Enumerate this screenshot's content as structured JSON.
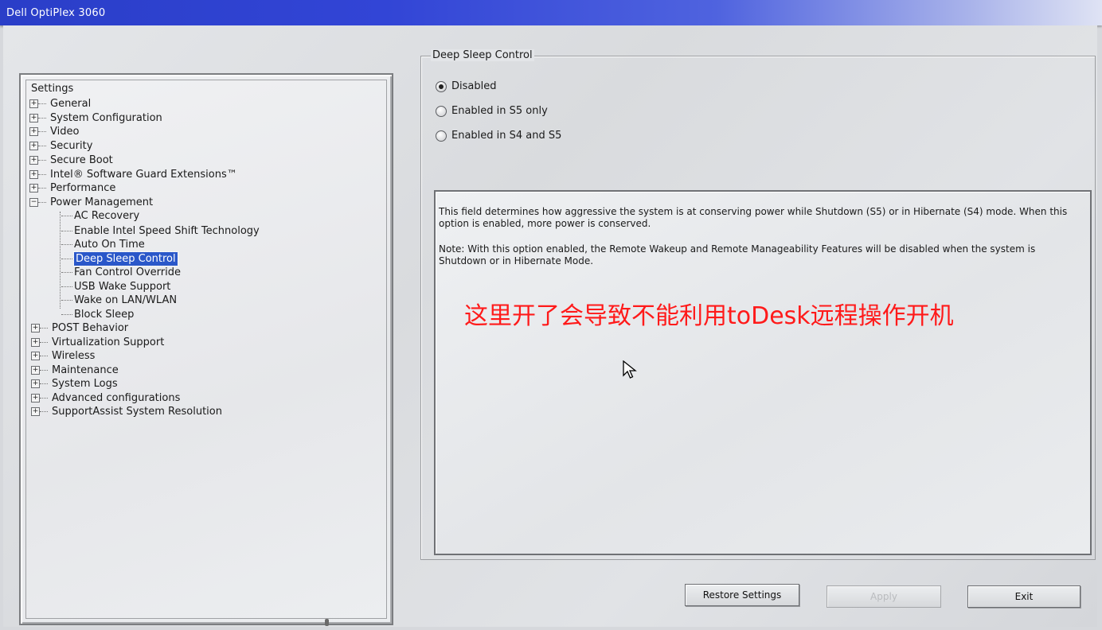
{
  "window": {
    "title": "Dell OptiPlex 3060"
  },
  "tree": {
    "root_label": "Settings",
    "items_before": [
      {
        "label": "General",
        "expander": "+"
      },
      {
        "label": "System Configuration",
        "expander": "+"
      },
      {
        "label": "Video",
        "expander": "+"
      },
      {
        "label": "Security",
        "expander": "+"
      },
      {
        "label": "Secure Boot",
        "expander": "+"
      },
      {
        "label": "Intel® Software Guard Extensions™",
        "expander": "+"
      },
      {
        "label": "Performance",
        "expander": "+"
      },
      {
        "label": "Power Management",
        "expander": "−"
      }
    ],
    "power_children": [
      {
        "label": "AC Recovery"
      },
      {
        "label": "Enable Intel Speed Shift Technology"
      },
      {
        "label": "Auto On Time"
      },
      {
        "label": "Deep Sleep Control",
        "selected": true
      },
      {
        "label": "Fan Control Override"
      },
      {
        "label": "USB Wake Support"
      },
      {
        "label": "Wake on LAN/WLAN"
      },
      {
        "label": "Block Sleep"
      }
    ],
    "items_after": [
      {
        "label": "POST Behavior",
        "expander": "+"
      },
      {
        "label": "Virtualization Support",
        "expander": "+"
      },
      {
        "label": "Wireless",
        "expander": "+"
      },
      {
        "label": "Maintenance",
        "expander": "+"
      },
      {
        "label": "System Logs",
        "expander": "+"
      },
      {
        "label": "Advanced configurations",
        "expander": "+"
      },
      {
        "label": "SupportAssist System Resolution",
        "expander": "+"
      }
    ]
  },
  "setting": {
    "group_title": "Deep Sleep Control",
    "options": [
      {
        "label": "Disabled",
        "selected": true
      },
      {
        "label": "Enabled in S5 only",
        "selected": false
      },
      {
        "label": "Enabled in S4 and S5",
        "selected": false
      }
    ],
    "description": [
      "This field determines how aggressive the system is at conserving power while Shutdown (S5) or in Hibernate (S4) mode.  When this option is enabled, more power is conserved.",
      "Note:  With this option enabled, the Remote Wakeup and Remote Manageability Features will be disabled when the system is Shutdown or in Hibernate Mode."
    ],
    "annotation": "这里开了会导致不能利用toDesk远程操作开机"
  },
  "buttons": {
    "restore": "Restore Settings",
    "apply": "Apply",
    "exit": "Exit"
  },
  "colors": {
    "selection": "#2a57c9",
    "annotation": "#ff1a1a",
    "titlebar": "#3245d6"
  }
}
